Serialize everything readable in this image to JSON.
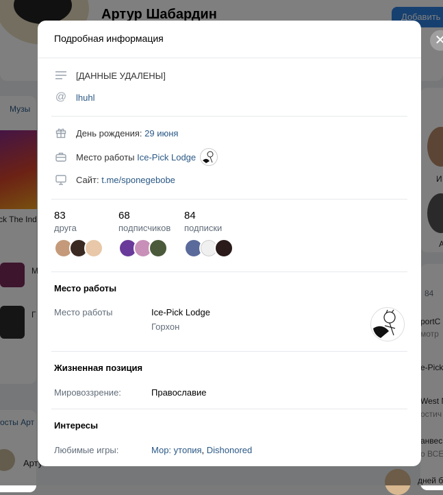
{
  "background": {
    "profile_name": "Артур Шабардин",
    "add_button": "Добавить",
    "music_label": "Музы",
    "track_fragment": "ck The Ind",
    "track_letter_1": "M",
    "track_letter_2": "Г",
    "posts_label": "осты Арт",
    "footer_name": "Арту",
    "right_letter_1": "И",
    "right_letter_2": "А",
    "right_count": "84",
    "right_snippet_1": "portC",
    "right_snippet_2": "мотр",
    "right_snippet_3": "e-Pick",
    "right_snippet_4": "West N",
    "right_snippet_5": "остич",
    "right_snippet_6": "анвес",
    "right_snippet_7": "о ВСЕ",
    "right_snippet_8": "дней б"
  },
  "modal": {
    "title": "Подробная информация",
    "status": "[ДАННЫЕ УДАЛЕНЫ]",
    "nickname": "lhuhl",
    "birthday_label": "День рождения:",
    "birthday_value": "29 июня",
    "work_label": "Место работы",
    "work_value": "Ice-Pick Lodge",
    "site_label": "Сайт:",
    "site_value": "t.me/sponegebobe",
    "stats": [
      {
        "count": "83",
        "label": "друга"
      },
      {
        "count": "68",
        "label": "подписчиков"
      },
      {
        "count": "84",
        "label": "подписки"
      }
    ],
    "work_section": {
      "title": "Место работы",
      "key": "Место работы",
      "company": "Ice-Pick Lodge",
      "position": "Горхон"
    },
    "life_section": {
      "title": "Жизненная позиция",
      "key": "Мировоззрение:",
      "value": "Православие"
    },
    "interests_section": {
      "title": "Интересы",
      "key": "Любимые игры:",
      "game_1": "Мор: утопия",
      "separator": ", ",
      "game_2": "Dishonored"
    }
  },
  "icons": {
    "status": "lines-icon",
    "nickname": "at-icon",
    "birthday": "gift-icon",
    "work": "briefcase-icon",
    "site": "monitor-icon",
    "close": "close-icon"
  }
}
